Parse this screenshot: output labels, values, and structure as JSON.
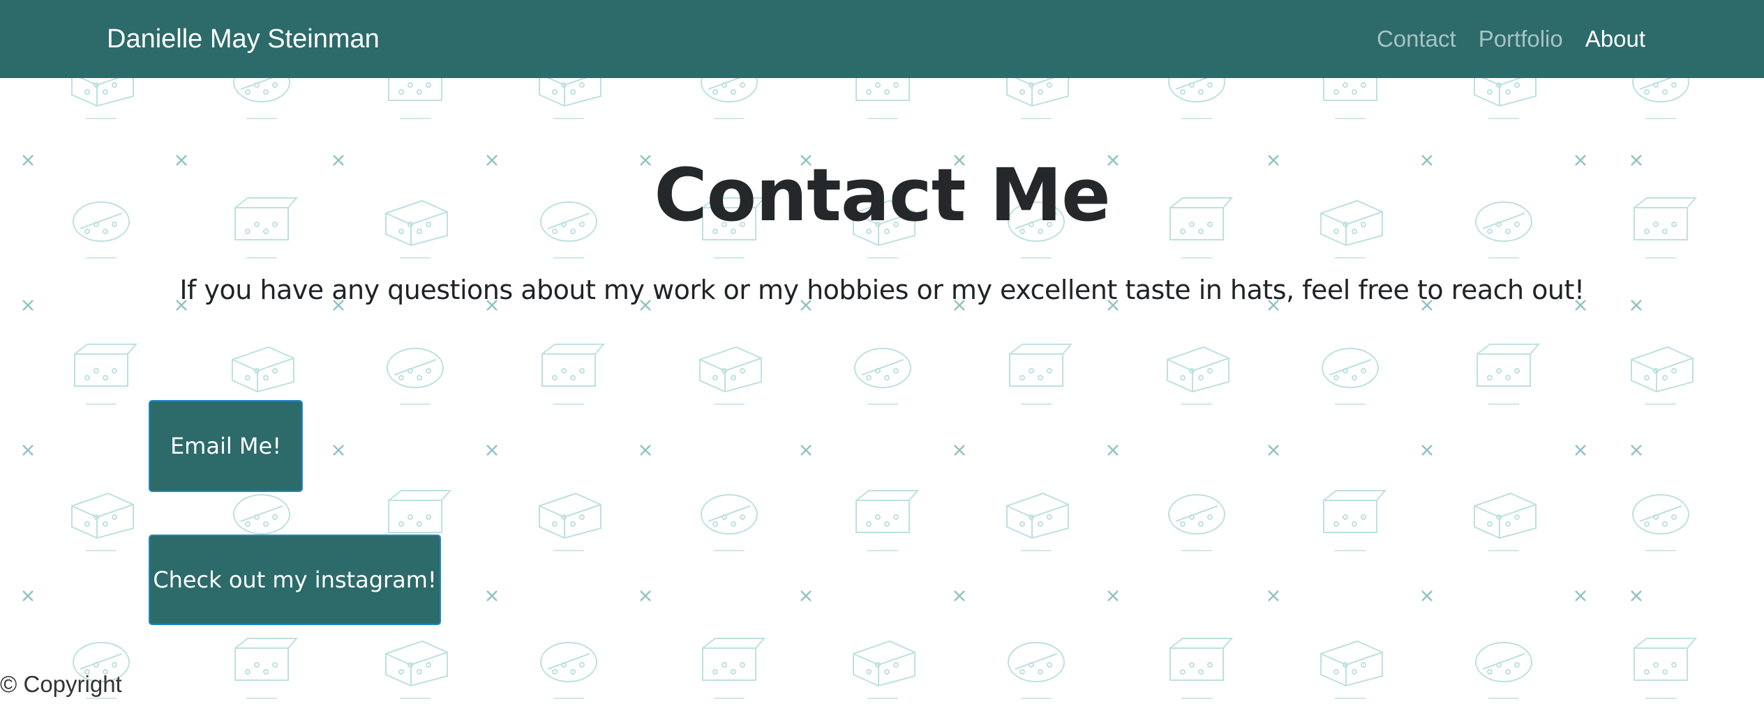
{
  "navbar": {
    "brand": "Danielle May Steinman",
    "links": [
      {
        "label": "Contact",
        "active": false
      },
      {
        "label": "Portfolio",
        "active": false
      },
      {
        "label": "About",
        "active": true
      }
    ]
  },
  "main": {
    "title": "Contact Me",
    "subtitle": "If you have any questions about my work or my hobbies or my excellent taste in hats, feel free to reach out!",
    "buttons": {
      "email": "Email Me!",
      "instagram": "Check out my instagram!"
    }
  },
  "footer": {
    "copyright": "© Copyright"
  },
  "colors": {
    "navbar_bg": "#2d6a6a",
    "button_bg": "#2d6a6a",
    "button_border": "#1e88c7",
    "pattern": "#6fbcbc",
    "title": "#24282b"
  },
  "background": {
    "pattern_icon": "cheese-icon",
    "marker_icon": "x-mark-icon"
  }
}
